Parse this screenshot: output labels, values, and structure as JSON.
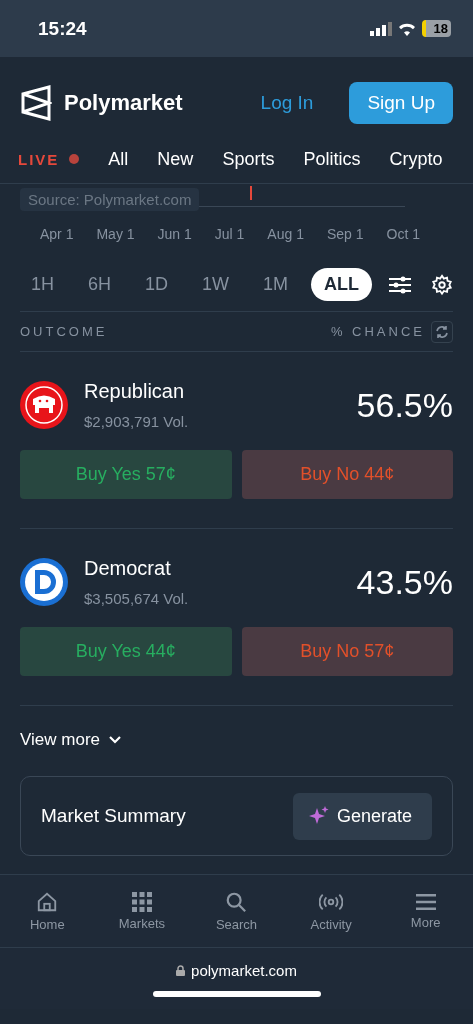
{
  "status_bar": {
    "time": "15:24",
    "battery": "18"
  },
  "header": {
    "brand": "Polymarket",
    "login": "Log In",
    "signup": "Sign Up"
  },
  "categories": [
    {
      "label": "LIVE",
      "kind": "live"
    },
    {
      "label": "All",
      "kind": "link"
    },
    {
      "label": "New",
      "kind": "link"
    },
    {
      "label": "Sports",
      "kind": "link"
    },
    {
      "label": "Politics",
      "kind": "link"
    },
    {
      "label": "Crypto",
      "kind": "link"
    }
  ],
  "chart": {
    "source": "Source: Polymarket.com",
    "x_labels": [
      "Apr 1",
      "May 1",
      "Jun 1",
      "Jul 1",
      "Aug 1",
      "Sep 1",
      "Oct 1"
    ]
  },
  "time_ranges": [
    {
      "label": "1H",
      "selected": false
    },
    {
      "label": "6H",
      "selected": false
    },
    {
      "label": "1D",
      "selected": false
    },
    {
      "label": "1W",
      "selected": false
    },
    {
      "label": "1M",
      "selected": false
    },
    {
      "label": "ALL",
      "selected": true
    }
  ],
  "table_header": {
    "outcome": "OUTCOME",
    "chance": "% CHANCE"
  },
  "outcomes": [
    {
      "name": "Republican",
      "volume": "$2,903,791 Vol.",
      "chance": "56.5%",
      "buy_yes": "Buy Yes 57¢",
      "buy_no": "Buy No 44¢",
      "kind": "republican"
    },
    {
      "name": "Democrat",
      "volume": "$3,505,674 Vol.",
      "chance": "43.5%",
      "buy_yes": "Buy Yes 44¢",
      "buy_no": "Buy No 57¢",
      "kind": "democrat"
    }
  ],
  "view_more": "View more",
  "market_summary": {
    "title": "Market Summary",
    "button": "Generate"
  },
  "bottom_nav": [
    {
      "label": "Home",
      "kind": "home"
    },
    {
      "label": "Markets",
      "kind": "markets"
    },
    {
      "label": "Search",
      "kind": "search"
    },
    {
      "label": "Activity",
      "kind": "activity"
    },
    {
      "label": "More",
      "kind": "more"
    }
  ],
  "url": "polymarket.com"
}
